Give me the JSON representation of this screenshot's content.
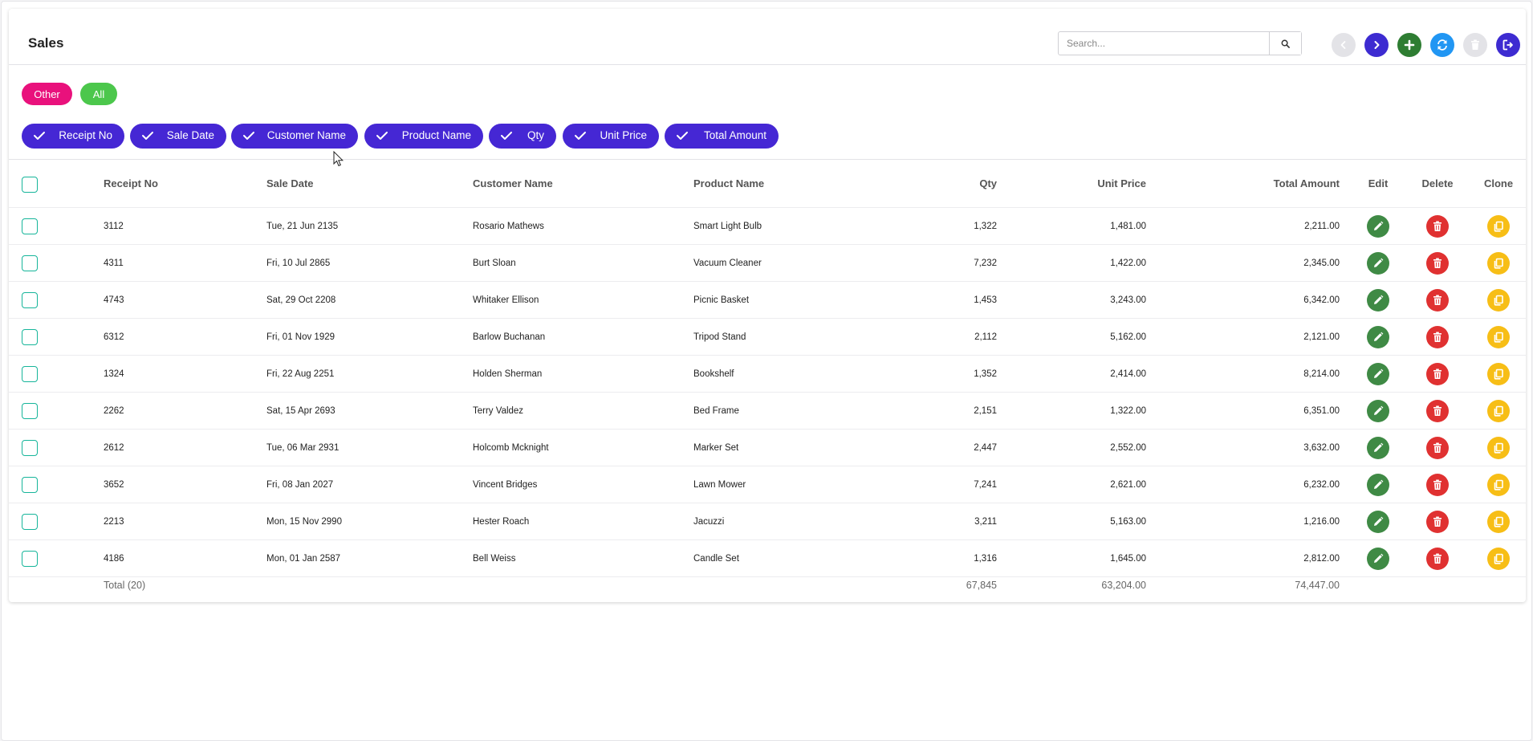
{
  "page": {
    "title": "Sales"
  },
  "search": {
    "placeholder": "Search...",
    "value": ""
  },
  "toolbar": {
    "buttons": [
      {
        "icon": "chevron-left-icon",
        "color": "#e3e3e7",
        "enabled": false
      },
      {
        "icon": "chevron-right-icon",
        "color": "#3d2bd1",
        "enabled": true
      },
      {
        "icon": "plus-icon",
        "color": "#2e7d32",
        "enabled": true
      },
      {
        "icon": "refresh-icon",
        "color": "#2196f3",
        "enabled": true
      },
      {
        "icon": "trash-icon",
        "color": "#e3e3e7",
        "enabled": false
      },
      {
        "icon": "logout-icon",
        "color": "#3d2bd1",
        "enabled": true
      }
    ]
  },
  "filters": {
    "tags": [
      {
        "label": "Other",
        "color": "#e9117c"
      },
      {
        "label": "All",
        "color": "#4cc74c"
      }
    ]
  },
  "column_chips": [
    "Receipt No",
    "Sale Date",
    "Customer Name",
    "Product Name",
    "Qty",
    "Unit Price",
    "Total Amount"
  ],
  "table": {
    "headers": {
      "receipt_no": "Receipt No",
      "sale_date": "Sale Date",
      "customer_name": "Customer Name",
      "product_name": "Product Name",
      "qty": "Qty",
      "unit_price": "Unit Price",
      "total_amount": "Total Amount",
      "edit": "Edit",
      "delete": "Delete",
      "clone": "Clone"
    },
    "rows": [
      {
        "receipt_no": "3112",
        "sale_date": "Tue, 21 Jun 2135",
        "customer_name": "Rosario Mathews",
        "product_name": "Smart Light Bulb",
        "qty": "1,322",
        "unit_price": "1,481.00",
        "total_amount": "2,211.00"
      },
      {
        "receipt_no": "4311",
        "sale_date": "Fri, 10 Jul 2865",
        "customer_name": "Burt Sloan",
        "product_name": "Vacuum Cleaner",
        "qty": "7,232",
        "unit_price": "1,422.00",
        "total_amount": "2,345.00"
      },
      {
        "receipt_no": "4743",
        "sale_date": "Sat, 29 Oct 2208",
        "customer_name": "Whitaker Ellison",
        "product_name": "Picnic Basket",
        "qty": "1,453",
        "unit_price": "3,243.00",
        "total_amount": "6,342.00"
      },
      {
        "receipt_no": "6312",
        "sale_date": "Fri, 01 Nov 1929",
        "customer_name": "Barlow Buchanan",
        "product_name": "Tripod Stand",
        "qty": "2,112",
        "unit_price": "5,162.00",
        "total_amount": "2,121.00"
      },
      {
        "receipt_no": "1324",
        "sale_date": "Fri, 22 Aug 2251",
        "customer_name": "Holden Sherman",
        "product_name": "Bookshelf",
        "qty": "1,352",
        "unit_price": "2,414.00",
        "total_amount": "8,214.00"
      },
      {
        "receipt_no": "2262",
        "sale_date": "Sat, 15 Apr 2693",
        "customer_name": "Terry Valdez",
        "product_name": "Bed Frame",
        "qty": "2,151",
        "unit_price": "1,322.00",
        "total_amount": "6,351.00"
      },
      {
        "receipt_no": "2612",
        "sale_date": "Tue, 06 Mar 2931",
        "customer_name": "Holcomb Mcknight",
        "product_name": "Marker Set",
        "qty": "2,447",
        "unit_price": "2,552.00",
        "total_amount": "3,632.00"
      },
      {
        "receipt_no": "3652",
        "sale_date": "Fri, 08 Jan 2027",
        "customer_name": "Vincent Bridges",
        "product_name": "Lawn Mower",
        "qty": "7,241",
        "unit_price": "2,621.00",
        "total_amount": "6,232.00"
      },
      {
        "receipt_no": "2213",
        "sale_date": "Mon, 15 Nov 2990",
        "customer_name": "Hester Roach",
        "product_name": "Jacuzzi",
        "qty": "3,211",
        "unit_price": "5,163.00",
        "total_amount": "1,216.00"
      },
      {
        "receipt_no": "4186",
        "sale_date": "Mon, 01 Jan 2587",
        "customer_name": "Bell Weiss",
        "product_name": "Candle Set",
        "qty": "1,316",
        "unit_price": "1,645.00",
        "total_amount": "2,812.00"
      }
    ],
    "totals": {
      "label": "Total (20)",
      "qty": "67,845",
      "unit_price": "63,204.00",
      "total_amount": "74,447.00"
    }
  },
  "colors": {
    "chip": "#4527d4",
    "checkbox": "#16b59a",
    "edit": "#3f8a45",
    "delete": "#e03131",
    "clone": "#f7be16"
  }
}
